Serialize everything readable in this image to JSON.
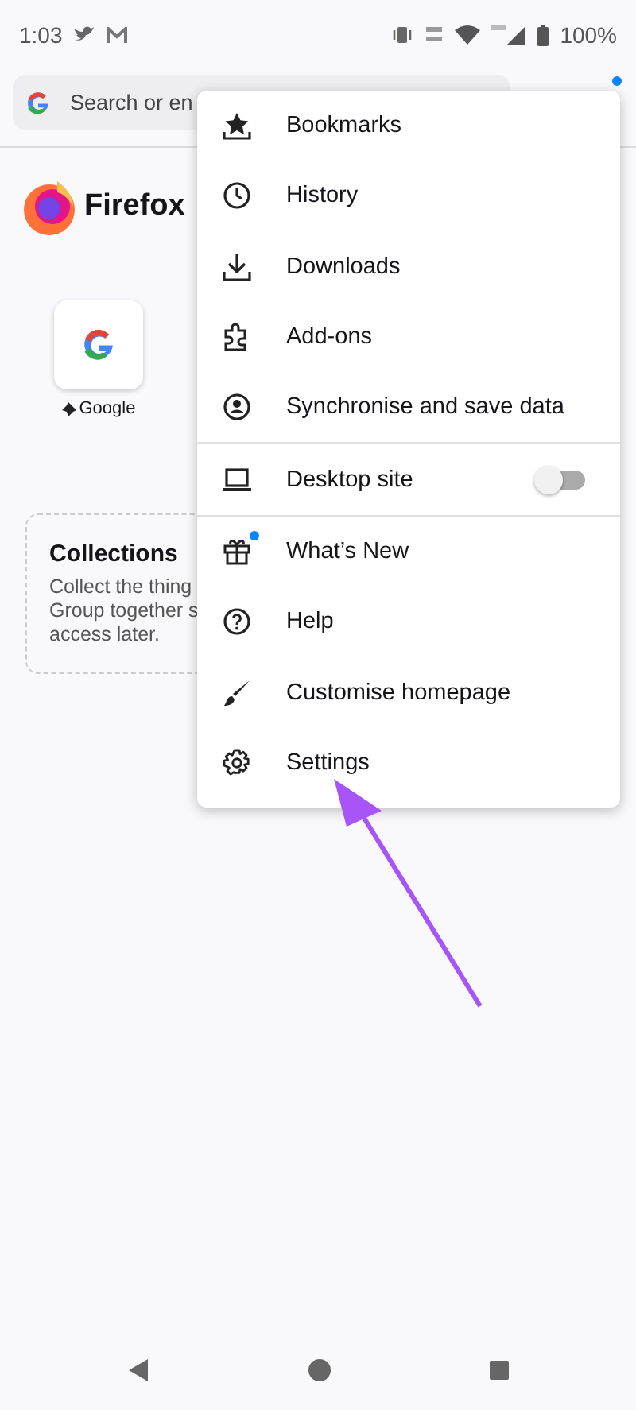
{
  "status_bar": {
    "time": "1:03",
    "battery": "100%"
  },
  "search": {
    "placeholder": "Search or en"
  },
  "brand": {
    "name": "Firefox"
  },
  "shortcuts": [
    {
      "label": "Google",
      "pinned": true
    }
  ],
  "collections": {
    "title": "Collections",
    "lines": [
      "Collect the thing",
      "Group together s",
      "access later."
    ]
  },
  "menu": {
    "items": [
      {
        "kind": "item",
        "label": "Bookmarks",
        "divider_after": false,
        "badge": false
      },
      {
        "kind": "item",
        "label": "History",
        "divider_after": false,
        "badge": false
      },
      {
        "kind": "item",
        "label": "Downloads",
        "divider_after": false,
        "badge": false
      },
      {
        "kind": "item",
        "label": "Add-ons",
        "divider_after": false,
        "badge": false
      },
      {
        "kind": "item",
        "label": "Synchronise and save data",
        "divider_after": true,
        "badge": false
      },
      {
        "kind": "toggle",
        "label": "Desktop site",
        "on": false,
        "divider_after": true,
        "badge": false
      },
      {
        "kind": "item",
        "label": "What’s New",
        "divider_after": false,
        "badge": true
      },
      {
        "kind": "item",
        "label": "Help",
        "divider_after": false,
        "badge": false
      },
      {
        "kind": "item",
        "label": "Customise homepage",
        "divider_after": false,
        "badge": false
      },
      {
        "kind": "item",
        "label": "Settings",
        "divider_after": false,
        "badge": false
      }
    ]
  }
}
